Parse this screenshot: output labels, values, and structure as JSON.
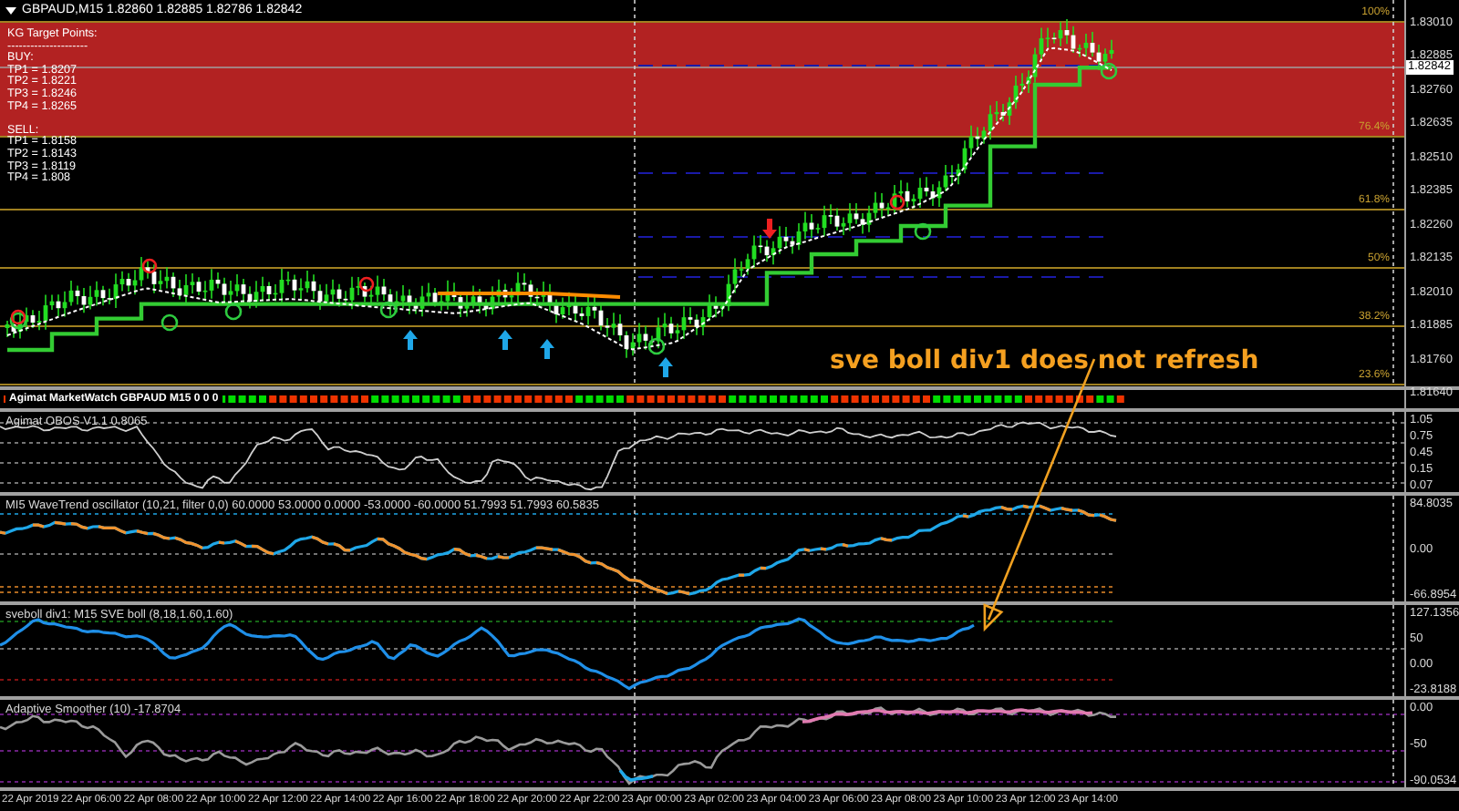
{
  "chart_title": "GBPAUD,M15  1.82860 1.82885 1.82786 1.82842",
  "target_panel": {
    "heading": "KG Target Points:",
    "separator": "---------------------",
    "buy_label": "BUY:",
    "buy_targets": [
      "TP1 = 1.8207",
      "TP2 = 1.8221",
      "TP3 = 1.8246",
      "TP4 = 1.8265"
    ],
    "sell_label": "SELL:",
    "sell_targets": [
      "TP1 = 1.8158",
      "TP2 = 1.8143",
      "TP3 = 1.8119",
      "TP4 = 1.808"
    ]
  },
  "main_chart": {
    "price_axis": [
      "1.83010",
      "1.82885",
      "1.82760",
      "1.82635",
      "1.82510",
      "1.82385",
      "1.82260",
      "1.82135",
      "1.82010",
      "1.81885",
      "1.81760",
      "1.81640"
    ],
    "current_price": "1.82842",
    "fib_levels": [
      "100%",
      "76.4%",
      "61.8%",
      "50%",
      "38.2%",
      "23.6%"
    ]
  },
  "annotation": {
    "text": "sve boll div1 does not refresh"
  },
  "panes": [
    {
      "kind": "signal_strip",
      "label": "Agimat MarketWatch GBPAUD M15 0 0 0"
    },
    {
      "kind": "obos",
      "label": "Agimat OBOS V1.1 0.8065",
      "axis": [
        "1.05",
        "0.75",
        "0.45",
        "0.15",
        "0.07"
      ]
    },
    {
      "kind": "wavetrend",
      "label": "MI5 WaveTrend oscillator (10,21, filter 0,0) 60.0000 53.0000 0.0000 -53.0000 -60.0000 51.7993 51.7993 60.5835",
      "axis": [
        "84.8035",
        "0.00",
        "-66.8954"
      ]
    },
    {
      "kind": "sveboll",
      "label": "sveboll div1: M15 SVE boll (8,18,1.60,1.60)",
      "axis": [
        "127.1356",
        "50",
        "0.00",
        "-23.8188"
      ]
    },
    {
      "kind": "smoother",
      "label": "Adaptive Smoother (10) -17.8704",
      "axis": [
        "0.00",
        "-50",
        "-90.0534"
      ]
    }
  ],
  "time_axis": [
    "22 Apr 2019",
    "22 Apr 06:00",
    "22 Apr 08:00",
    "22 Apr 10:00",
    "22 Apr 12:00",
    "22 Apr 14:00",
    "22 Apr 16:00",
    "22 Apr 18:00",
    "22 Apr 20:00",
    "22 Apr 22:00",
    "23 Apr 00:00",
    "23 Apr 02:00",
    "23 Apr 04:00",
    "23 Apr 06:00",
    "23 Apr 08:00",
    "23 Apr 10:00",
    "23 Apr 12:00",
    "23 Apr 14:00"
  ]
}
